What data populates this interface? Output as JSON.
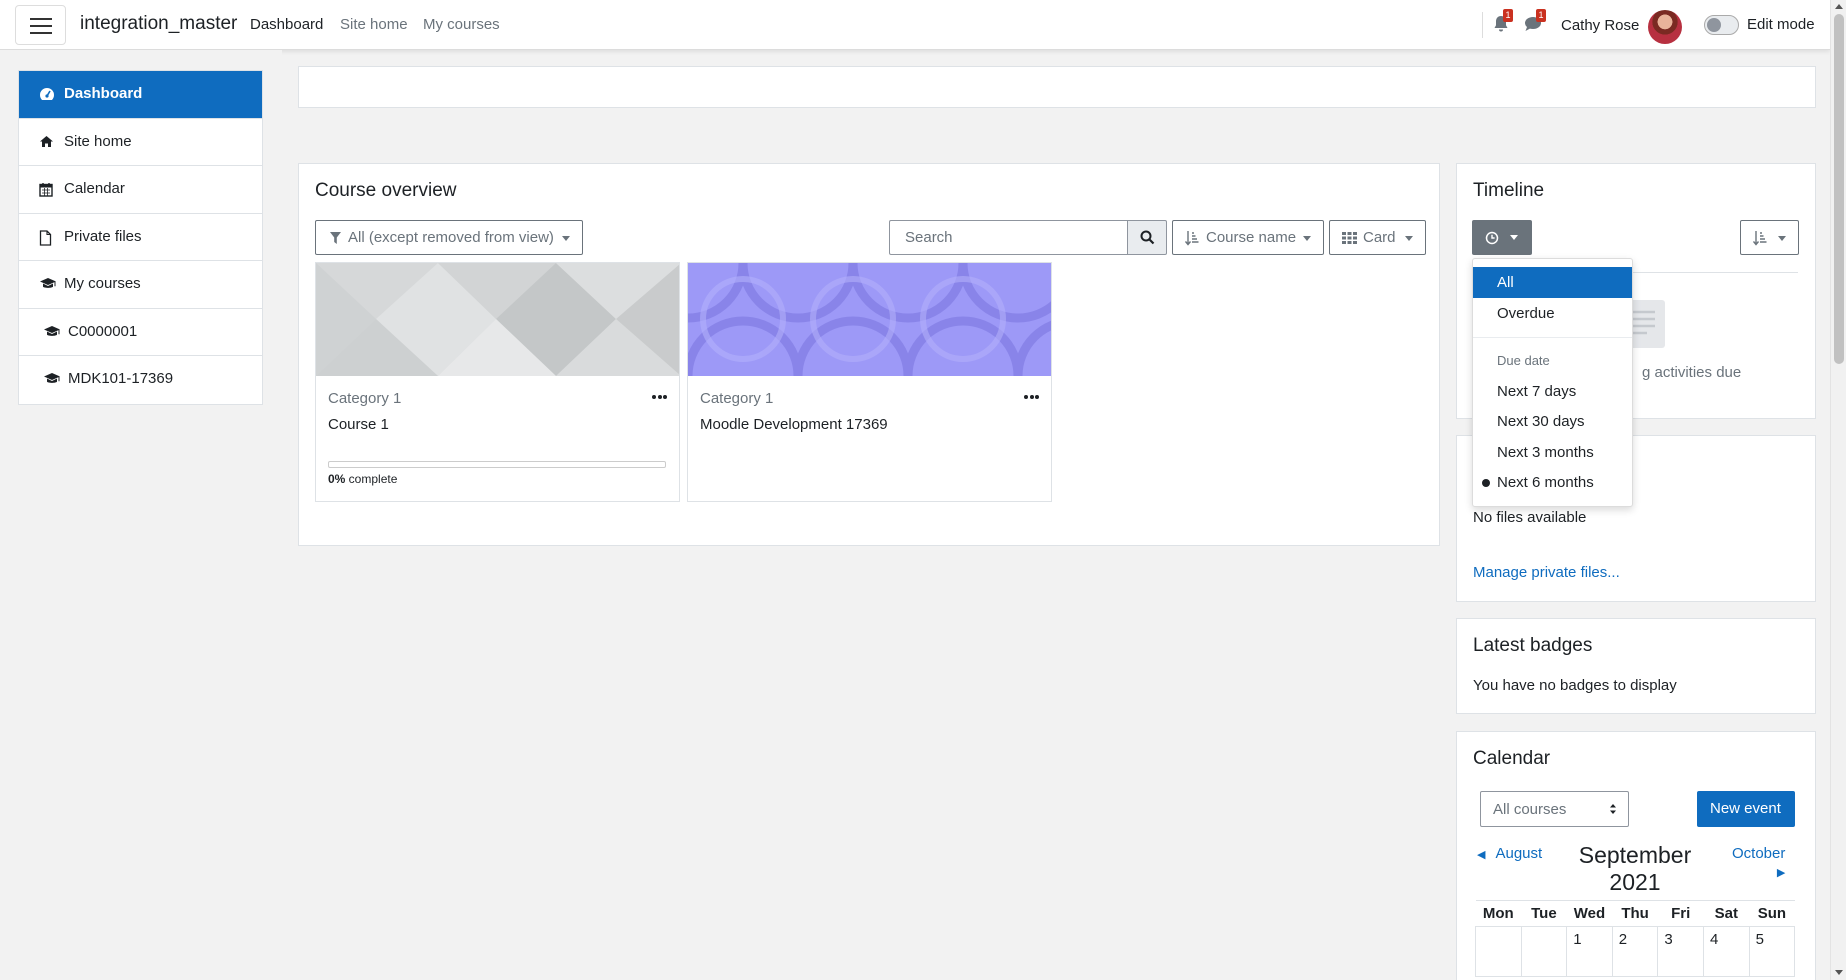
{
  "navbar": {
    "brand": "integration_master",
    "links": [
      "Dashboard",
      "Site home",
      "My courses"
    ],
    "notifications_count": "1",
    "messages_count": "1",
    "username": "Cathy Rose",
    "edit_mode_label": "Edit mode",
    "edit_mode_on": false
  },
  "drawer": {
    "items": [
      {
        "label": "Dashboard",
        "icon": "dashboard-icon",
        "active": true
      },
      {
        "label": "Site home",
        "icon": "home-icon"
      },
      {
        "label": "Calendar",
        "icon": "calendar-icon"
      },
      {
        "label": "Private files",
        "icon": "file-icon"
      },
      {
        "label": "My courses",
        "icon": "graduation-cap-icon"
      },
      {
        "label": "C0000001",
        "icon": "graduation-cap-icon"
      },
      {
        "label": "MDK101-17369",
        "icon": "graduation-cap-icon"
      }
    ]
  },
  "course_overview": {
    "title": "Course overview",
    "filter_label": "All (except removed from view)",
    "search_placeholder": "Search",
    "sort_label": "Course name",
    "view_label": "Card",
    "courses": [
      {
        "category": "Category 1",
        "name": "Course 1",
        "progress_pct": 0,
        "progress_value": "0%",
        "progress_suffix": " complete"
      },
      {
        "category": "Category 1",
        "name": "Moodle Development 17369"
      }
    ]
  },
  "timeline": {
    "title": "Timeline",
    "empty_text": "g activities due",
    "dropdown": {
      "items": [
        "All",
        "Overdue"
      ],
      "header": "Due date",
      "date_items": [
        "Next 7 days",
        "Next 30 days",
        "Next 3 months",
        "Next 6 months"
      ],
      "active": "All",
      "selected": "Next 6 months"
    }
  },
  "private_files": {
    "empty_text": "No files available",
    "manage_link": "Manage private files..."
  },
  "badges": {
    "title": "Latest badges",
    "empty_text": "You have no badges to display"
  },
  "calendar": {
    "title": "Calendar",
    "course_select": "All courses",
    "new_event": "New event",
    "prev_month": "August",
    "next_month": "October",
    "month": "September",
    "year": "2021",
    "weekdays": [
      "Mon",
      "Tue",
      "Wed",
      "Thu",
      "Fri",
      "Sat",
      "Sun"
    ],
    "first_row": [
      "",
      "",
      "1",
      "2",
      "3",
      "4",
      "5"
    ]
  },
  "colors": {
    "primary": "#0f6cbf",
    "badge": "#ca3120",
    "secondary": "#6a737b"
  }
}
